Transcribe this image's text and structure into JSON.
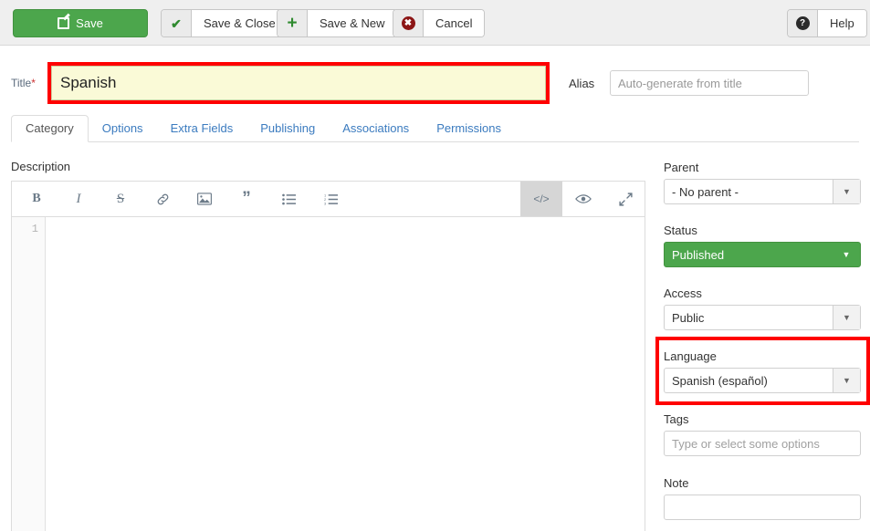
{
  "toolbar": {
    "save": {
      "label": "Save",
      "icon": "save-document-icon"
    },
    "save_close": {
      "label": "Save & Close",
      "icon": "check-icon"
    },
    "save_new": {
      "label": "Save & New",
      "icon": "plus-icon"
    },
    "cancel": {
      "label": "Cancel",
      "icon": "cancel-circle-icon"
    },
    "help": {
      "label": "Help",
      "icon": "help-circle-icon"
    }
  },
  "form": {
    "title_label": "Title",
    "title_required_marker": "*",
    "title_value": "Spanish",
    "alias_label": "Alias",
    "alias_placeholder": "Auto-generate from title",
    "description_label": "Description"
  },
  "tabs": [
    {
      "label": "Category",
      "active": true
    },
    {
      "label": "Options",
      "active": false
    },
    {
      "label": "Extra Fields",
      "active": false
    },
    {
      "label": "Publishing",
      "active": false
    },
    {
      "label": "Associations",
      "active": false
    },
    {
      "label": "Permissions",
      "active": false
    }
  ],
  "editor": {
    "buttons": [
      {
        "name": "bold",
        "glyph": "B"
      },
      {
        "name": "italic",
        "glyph": "I"
      },
      {
        "name": "strikethrough",
        "glyph": "S"
      },
      {
        "name": "link",
        "glyph": "&#128279;"
      },
      {
        "name": "image",
        "glyph": "▣"
      },
      {
        "name": "quote",
        "glyph": "”"
      },
      {
        "name": "unordered-list",
        "glyph": "☰"
      },
      {
        "name": "ordered-list",
        "glyph": "☰"
      },
      {
        "name": "code-view",
        "glyph": "</>"
      },
      {
        "name": "preview",
        "glyph": "◉"
      },
      {
        "name": "fullscreen",
        "glyph": "⤡"
      }
    ],
    "line_number": "1",
    "content": ""
  },
  "sidebar": {
    "parent": {
      "label": "Parent",
      "value": "- No parent -"
    },
    "status": {
      "label": "Status",
      "value": "Published"
    },
    "access": {
      "label": "Access",
      "value": "Public"
    },
    "language": {
      "label": "Language",
      "value": "Spanish (español)"
    },
    "tags": {
      "label": "Tags",
      "placeholder": "Type or select some options",
      "value": ""
    },
    "note": {
      "label": "Note",
      "value": ""
    }
  },
  "annotations": {
    "color": "#ff0000",
    "highlights": [
      "title-field",
      "language-field"
    ]
  },
  "colors": {
    "primary_green": "#4ca64c",
    "link_blue": "#3b7bbf",
    "title_field_yellow": "#fafad7",
    "annotation_red": "#ff0000"
  }
}
